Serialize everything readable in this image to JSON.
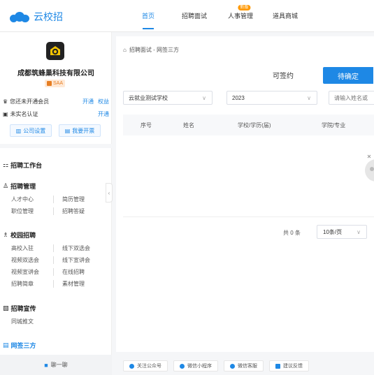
{
  "app": {
    "logo_text": "云校招"
  },
  "nav": {
    "items": [
      {
        "label": "首页",
        "active": true
      },
      {
        "label": "招聘面试",
        "active": false
      },
      {
        "label": "人事管理",
        "active": false,
        "badge": "新版"
      },
      {
        "label": "道具商城",
        "active": false
      }
    ]
  },
  "sidebar": {
    "company_name": "成都筑蜂巢科技有限公司",
    "saa_badge": "SAA",
    "member_text": "您还未开通会员",
    "member_open": "开通",
    "member_rights": "权益",
    "realname_text": "未实名认证",
    "realname_open": "开通",
    "company_settings": "公司设置",
    "invoice": "我要开票",
    "workbench": "招聘工作台",
    "sections": [
      {
        "title": "招聘管理",
        "items": [
          "人才中心",
          "简历管理",
          "职位管理",
          "招聘答疑"
        ]
      },
      {
        "title": "校园招聘",
        "items": [
          "高校入驻",
          "线下双选会",
          "视频双选会",
          "线下宣讲会",
          "视频宣讲会",
          "在线招聘",
          "招聘简章",
          "素材管理"
        ]
      },
      {
        "title": "招聘宣传",
        "items": [
          "同城推文"
        ]
      }
    ],
    "active_section": "网签三方",
    "footer": "聊一聊"
  },
  "main": {
    "breadcrumb": "招聘面试 - 网签三方",
    "tab_signable": "可签约",
    "tab_pending": "待确定",
    "school_select": "云就业测试学校",
    "year_select": "2023",
    "search_placeholder": "请输入姓名或",
    "columns": [
      "序号",
      "姓名",
      "学校/学历(届)",
      "学院/专业"
    ],
    "total": "共 0 条",
    "page_size": "10条/页"
  },
  "footer": {
    "buttons": [
      "关注公众号",
      "微信小程序",
      "微信客服",
      "建议反馈"
    ]
  },
  "colors": {
    "primary": "#1e88e5",
    "orange": "#ff9800"
  }
}
